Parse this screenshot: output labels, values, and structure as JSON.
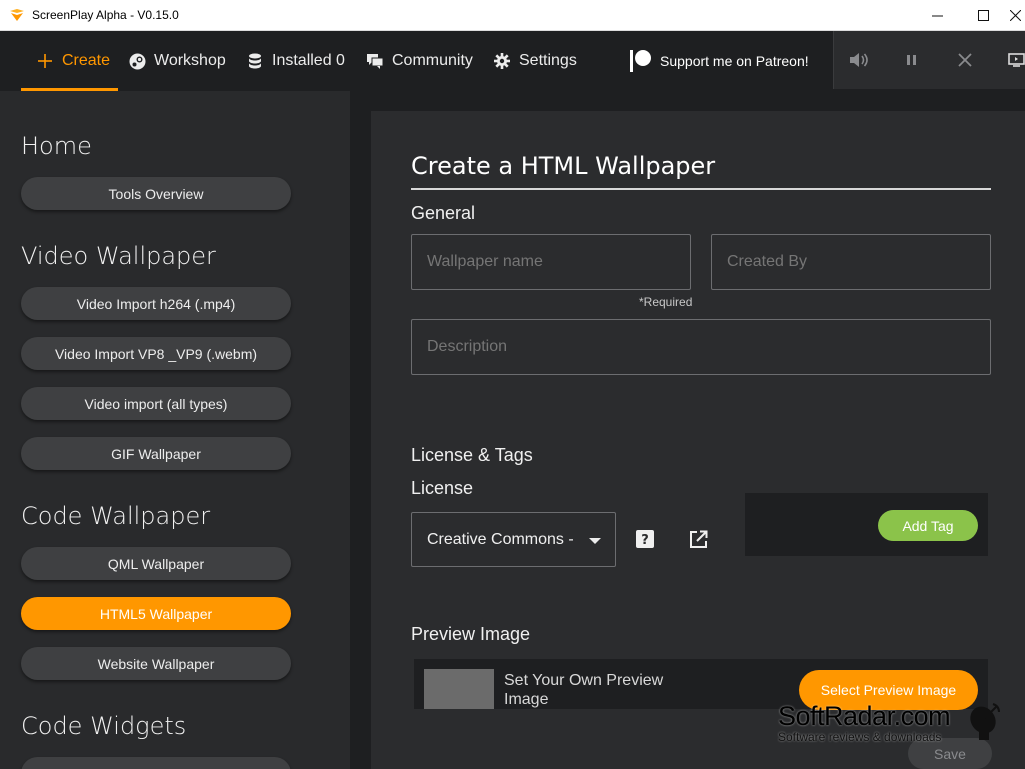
{
  "window": {
    "title": "ScreenPlay Alpha - V0.15.0",
    "minimize": "—",
    "maximize": "☐",
    "close": "✕"
  },
  "nav": {
    "create": "Create",
    "workshop": "Workshop",
    "installed": "Installed 0",
    "community": "Community",
    "settings": "Settings",
    "patreon": "Support me on Patreon!"
  },
  "colors": {
    "accent": "#ff9700",
    "tag_button": "#8bc34a",
    "background": "#1e1f21",
    "sidebar": "#292a2c",
    "panel": "#2b2c2e"
  },
  "sidebar": {
    "sections": [
      {
        "title": "Home",
        "items": [
          "Tools Overview"
        ]
      },
      {
        "title": "Video Wallpaper",
        "items": [
          "Video Import h264 (.mp4)",
          "Video Import VP8 _VP9 (.webm)",
          "Video import (all types)",
          "GIF Wallpaper"
        ]
      },
      {
        "title": "Code Wallpaper",
        "items": [
          "QML Wallpaper",
          "HTML5 Wallpaper",
          "Website Wallpaper"
        ]
      },
      {
        "title": "Code Widgets",
        "items": []
      }
    ],
    "active_item": "HTML5 Wallpaper"
  },
  "main": {
    "title": "Create a HTML Wallpaper",
    "general_label": "General",
    "wallpaper_name_placeholder": "Wallpaper name",
    "created_by_placeholder": "Created By",
    "required_note": "*Required",
    "description_placeholder": "Description",
    "license_tags_label": "License & Tags",
    "license_label": "License",
    "license_value": "Creative Commons - Attribution",
    "license_help_icon": "question-icon",
    "license_link_icon": "external-link-icon",
    "add_tag": "Add Tag",
    "preview_label": "Preview Image",
    "preview_text": "Set Your Own Preview Image",
    "select_preview": "Select Preview Image",
    "save": "Save"
  },
  "watermark": {
    "brand": "SoftRadar.com",
    "tagline": "Software reviews & downloads"
  }
}
